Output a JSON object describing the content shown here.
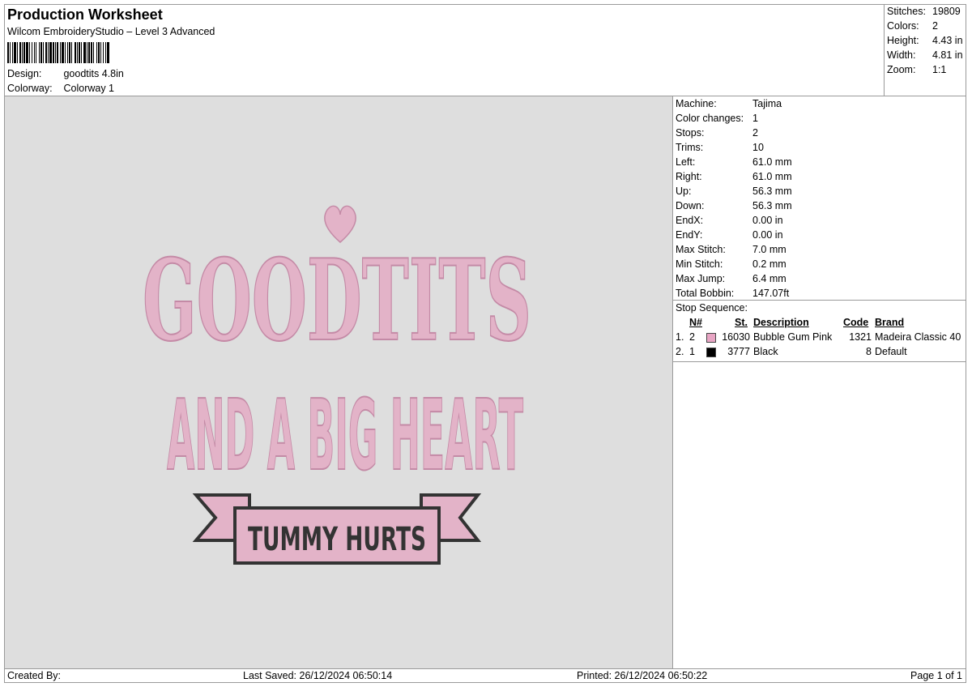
{
  "header": {
    "title": "Production Worksheet",
    "software": "Wilcom EmbroideryStudio – Level 3 Advanced",
    "design_label": "Design:",
    "design_value": "goodtits 4.8in",
    "colorway_label": "Colorway:",
    "colorway_value": "Colorway 1"
  },
  "summary": [
    {
      "label": "Stitches:",
      "value": "19809"
    },
    {
      "label": "Colors:",
      "value": "2"
    },
    {
      "label": "Height:",
      "value": "4.43 in"
    },
    {
      "label": "Width:",
      "value": "4.81 in"
    },
    {
      "label": "Zoom:",
      "value": "1:1"
    }
  ],
  "machine": [
    {
      "label": "Machine:",
      "value": "Tajima"
    },
    {
      "label": "Color changes:",
      "value": "1"
    },
    {
      "label": "Stops:",
      "value": "2"
    },
    {
      "label": "Trims:",
      "value": "10"
    },
    {
      "label": "Left:",
      "value": "61.0 mm"
    },
    {
      "label": "Right:",
      "value": "61.0 mm"
    },
    {
      "label": "Up:",
      "value": "56.3 mm"
    },
    {
      "label": "Down:",
      "value": "56.3 mm"
    },
    {
      "label": "EndX:",
      "value": "0.00 in"
    },
    {
      "label": "EndY:",
      "value": "0.00 in"
    },
    {
      "label": "Max Stitch:",
      "value": "7.0 mm"
    },
    {
      "label": "Min Stitch:",
      "value": "0.2 mm"
    },
    {
      "label": "Max Jump:",
      "value": "6.4 mm"
    },
    {
      "label": "Total Bobbin:",
      "value": "147.07ft"
    }
  ],
  "stop_sequence": {
    "label": "Stop Sequence:",
    "columns": {
      "n": "N#",
      "st": "St.",
      "desc": "Description",
      "code": "Code",
      "brand": "Brand"
    },
    "rows": [
      {
        "idx": "1.",
        "n": "2",
        "color": "#e8a5c4",
        "st": "16030",
        "desc": "Bubble Gum Pink",
        "code": "1321",
        "brand": "Madeira Classic 40"
      },
      {
        "idx": "2.",
        "n": "1",
        "color": "#000000",
        "st": "3777",
        "desc": "Black",
        "code": "8",
        "brand": "Default"
      }
    ]
  },
  "design_text": {
    "line1": "GOODTITS",
    "line2": "AND A BIG HEART",
    "banner": "TUMMY HURTS"
  },
  "colors": {
    "pink": "#e3b3c8",
    "pink_dark": "#c48aa6",
    "outline": "#333333",
    "canvas": "#dedede"
  },
  "footer": {
    "created_by": "Created By:",
    "last_saved": "Last Saved: 26/12/2024 06:50:14",
    "printed": "Printed: 26/12/2024 06:50:22",
    "page": "Page 1 of 1"
  }
}
